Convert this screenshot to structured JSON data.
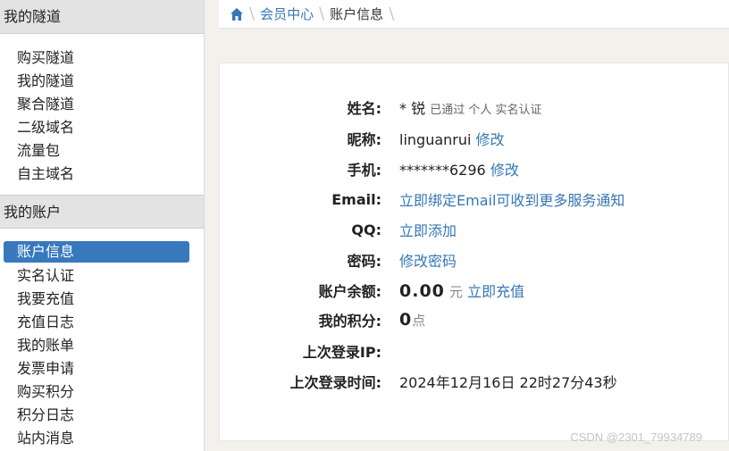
{
  "sidebar": {
    "sections": [
      {
        "header": "我的隧道",
        "items": [
          "购买隧道",
          "我的隧道",
          "聚合隧道",
          "二级域名",
          "流量包",
          "自主域名"
        ]
      },
      {
        "header": "我的账户",
        "items": [
          "账户信息",
          "实名认证",
          "我要充值",
          "充值日志",
          "我的账单",
          "发票申请",
          "购买积分",
          "积分日志",
          "站内消息"
        ],
        "active_item": "账户信息"
      }
    ]
  },
  "breadcrumb": {
    "home_icon": "home-icon",
    "items": [
      "会员中心",
      "账户信息"
    ]
  },
  "account": {
    "name": {
      "label": "姓名:",
      "value": "* 锐",
      "note": "已通过 个人 实名认证"
    },
    "nickname": {
      "label": "昵称:",
      "value": "linguanrui",
      "action": "修改"
    },
    "phone": {
      "label": "手机:",
      "value": "*******6296",
      "action": "修改"
    },
    "email": {
      "label": "Email:",
      "action": "立即绑定Email可收到更多服务通知"
    },
    "qq": {
      "label": "QQ:",
      "action": "立即添加"
    },
    "password": {
      "label": "密码:",
      "action": "修改密码"
    },
    "balance": {
      "label": "账户余额:",
      "value": "0.00",
      "unit": "元",
      "action": "立即充值"
    },
    "points": {
      "label": "我的积分:",
      "value": "0",
      "unit": "点"
    },
    "last_ip": {
      "label": "上次登录IP:",
      "value": ""
    },
    "last_time": {
      "label": "上次登录时间:",
      "value": "2024年12月16日 22时27分43秒"
    }
  },
  "watermark": "CSDN @2301_79934789",
  "colors": {
    "accent": "#3577b5",
    "active_bg": "#3879bd"
  }
}
